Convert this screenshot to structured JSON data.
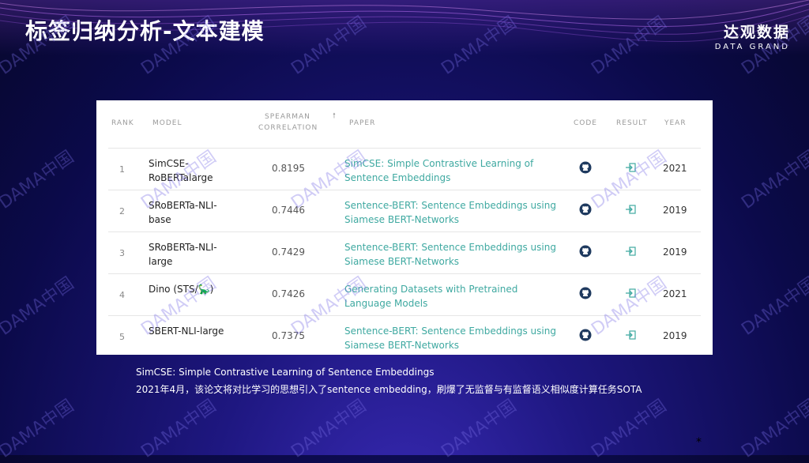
{
  "header": {
    "title": "标签归纳分析-文本建模",
    "brand_cn": "达观数据",
    "brand_en": "DATA GRAND"
  },
  "table": {
    "columns": {
      "rank": "RANK",
      "model": "MODEL",
      "spearman_line1": "SPEARMAN",
      "spearman_line2": "CORRELATION",
      "paper": "PAPER",
      "code": "CODE",
      "result": "RESULT",
      "year": "YEAR"
    },
    "rows": [
      {
        "rank": "1",
        "model": "SimCSE-RoBERTalarge",
        "corr": "0.8195",
        "paper": "SimCSE: Simple Contrastive Learning of Sentence Embeddings",
        "year": "2021"
      },
      {
        "rank": "2",
        "model": "SRoBERTa-NLI-base",
        "corr": "0.7446",
        "paper": "Sentence-BERT: Sentence Embeddings using Siamese BERT-Networks",
        "year": "2019"
      },
      {
        "rank": "3",
        "model": "SRoBERTa-NLI-large",
        "corr": "0.7429",
        "paper": "Sentence-BERT: Sentence Embeddings using Siamese BERT-Networks",
        "year": "2019"
      },
      {
        "rank": "4",
        "model": "Dino (STS/🦕)",
        "corr": "0.7426",
        "paper": "Generating Datasets with Pretrained Language Models",
        "year": "2021"
      },
      {
        "rank": "5",
        "model": "SBERT-NLI-large",
        "corr": "0.7375",
        "paper": "Sentence-BERT: Sentence Embeddings using Siamese BERT-Networks",
        "year": "2019"
      }
    ],
    "icons": {
      "code": "github-icon",
      "result": "result-link-icon",
      "sort": "sort-arrow-icon"
    }
  },
  "caption": {
    "line1": "SimCSE: Simple Contrastive Learning of Sentence Embeddings",
    "line2": "2021年4月，该论文将对比学习的思想引入了sentence embedding，刷爆了无监督与有监督语义相似度计算任务SOTA"
  },
  "footer": {
    "mark": "*"
  },
  "watermark": "DAMA中国",
  "colors": {
    "link": "#3fa9a1",
    "background": "#1e1780"
  }
}
